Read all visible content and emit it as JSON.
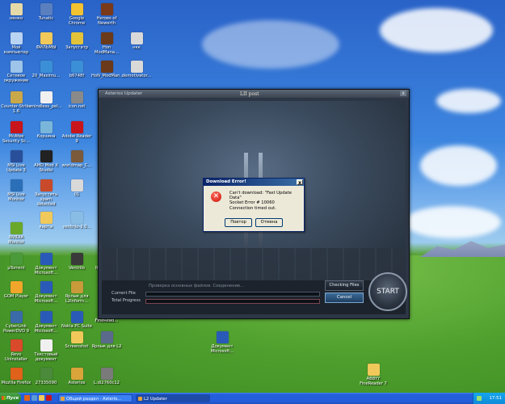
{
  "desktop_icons": [
    {
      "label": "ненко",
      "color": "#e6d9a8"
    },
    {
      "label": "Tunatic",
      "color": "#5a7fbf"
    },
    {
      "label": "Google\nChrome",
      "color": "#f2c230"
    },
    {
      "label": "Heroes of\nNewerth",
      "color": "#7a3a1a"
    },
    {
      "label": "Мой\nкомпьютер",
      "color": "#b9d3f2"
    },
    {
      "label": "ФИЛЬМЫ",
      "color": "#f0c95a"
    },
    {
      "label": "Запусгатр",
      "color": "#e2c33a"
    },
    {
      "label": "Hon\nModMana...",
      "color": "#6b3a1a"
    },
    {
      "label": "нкк",
      "color": "#d9d9d9"
    },
    {
      "label": "Сетевое\nокружение",
      "color": "#9ec4ea"
    },
    {
      "label": "20_Maximu...",
      "color": "#3b8fd6"
    },
    {
      "label": "b6748f",
      "color": "#3b8fd6"
    },
    {
      "label": "HoN_ModMan...",
      "color": "#6b3a1a"
    },
    {
      "label": "demotivator...",
      "color": "#d9d9d9"
    },
    {
      "label": "Counter-Strike\n1.6",
      "color": "#c9a84a"
    },
    {
      "label": "mindless_pel...",
      "color": "#f0f0f0"
    },
    {
      "label": "icon.net",
      "color": "#8a8a8a"
    },
    {
      "label": "McAfee\nSecurity Sc...",
      "color": "#c8151b"
    },
    {
      "label": "Корзина",
      "color": "#7ab6d9"
    },
    {
      "label": "Adobe Reader\n9",
      "color": "#c8151b"
    },
    {
      "label": "MSI Live\nUpdate 3",
      "color": "#2a4f9a"
    },
    {
      "label": "AMD Mod X\nStudio",
      "color": "#222222"
    },
    {
      "label": "worldmap_C...",
      "color": "#7a5a3a"
    },
    {
      "label": "MSI Live\nMonitor",
      "color": "#2a6fb8"
    },
    {
      "label": "Запустить\nspam detected",
      "color": "#c84a2a"
    },
    {
      "label": "01",
      "color": "#d9d9d9"
    },
    {
      "label": "карты",
      "color": "#f0c95a"
    },
    {
      "label": "ventrilo-3.0...",
      "color": "#8abde6"
    },
    {
      "label": "NVIDIA\nMonitor",
      "color": "#6aa82a"
    },
    {
      "label": "µTorrent",
      "color": "#4a9a3a"
    },
    {
      "label": "Документ\nMicrosoft...",
      "color": "#2a5ab8"
    },
    {
      "label": "Ventrilo",
      "color": "#3a3a3a"
    },
    {
      "label": "Ярлык для\nMi...",
      "color": "#7a7a7a"
    },
    {
      "label": "GOM Player",
      "color": "#f0a62a"
    },
    {
      "label": "Документ\nMicrosoft...",
      "color": "#2a5ab8"
    },
    {
      "label": "Ярлык для\nL2Inform...",
      "color": "#c89a3a"
    },
    {
      "label": "FineRead...",
      "color": "#2a7ad0"
    },
    {
      "label": "CyberLink\nPowerDVD 9",
      "color": "#3a6aa8"
    },
    {
      "label": "Документ\nMicrosoft...",
      "color": "#2a5ab8"
    },
    {
      "label": "Nokia PC Suite",
      "color": "#2a5ab8"
    },
    {
      "label": "FineRead...",
      "color": "#2a7ad0"
    },
    {
      "label": "Revo\nUninstaller",
      "color": "#d84a2a"
    },
    {
      "label": "Текстовый\nдокумент",
      "color": "#f0f0f0"
    },
    {
      "label": "Screenshot",
      "color": "#f0c95a"
    },
    {
      "label": "Ярлык для L2",
      "color": "#5a6a8a"
    },
    {
      "label": "Mozilla Firefox",
      "color": "#e0621a"
    },
    {
      "label": "27335090",
      "color": "#4a8a3a"
    },
    {
      "label": "Asterios",
      "color": "#d9a53a"
    },
    {
      "label": "L.di2760c12",
      "color": "#7a7a7a"
    },
    {
      "label": "Документ\nMicrosoft...",
      "color": "#2a5ab8"
    },
    {
      "label": "ABBYY\nFineReader 7",
      "color": "#f0c95a"
    }
  ],
  "updater": {
    "title_left": "Asterios Updater",
    "title_center": "LII post",
    "close": "x",
    "status_message": "Проверка основных файлов. Соединение...",
    "current_file_label": "Current File",
    "total_progress_label": "Total Progress",
    "checking_files_button": "Checking Files",
    "cancel_button": "Cancel",
    "start_button": "START"
  },
  "dialog": {
    "title": "Download Error!",
    "close": "x",
    "error_glyph": "✕",
    "line1": "Can't download: \"Fast Update Data\"",
    "line2": "Socket Error # 10060",
    "line3": "Connection timed out.",
    "retry_button": "Повтор",
    "cancel_button": "Отмена"
  },
  "taskbar": {
    "start_label": "Пуск",
    "tasks": [
      "Общий раздел - Asterio...",
      "L2 Updater"
    ],
    "clock": "17:51"
  }
}
